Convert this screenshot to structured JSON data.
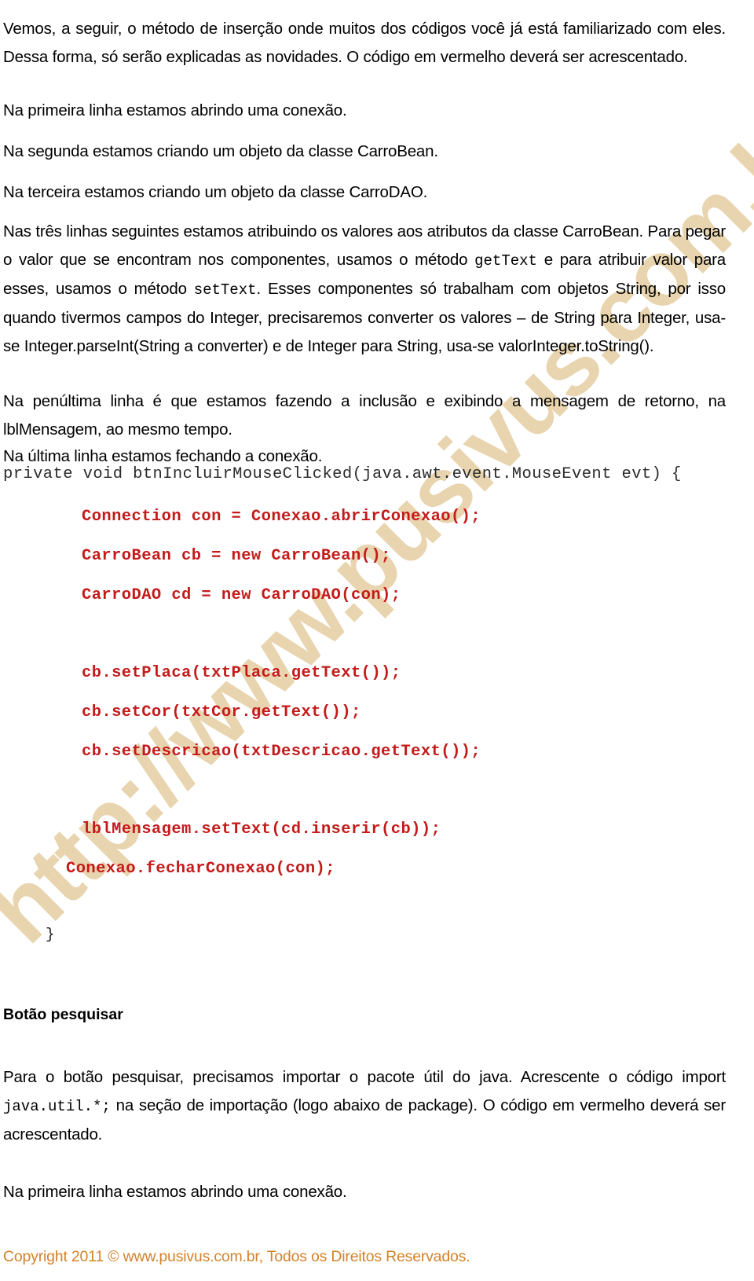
{
  "watermark": {
    "text": "http://www.pusivus.com.br"
  },
  "document": {
    "paragraphs": [
      {
        "id": "intro",
        "text": "Vemos, a seguir, o método de inserção onde muitos dos códigos você já está familiarizado com eles. Dessa forma, só serão explicadas as novidades. O código em vermelho deverá ser acrescentado."
      },
      {
        "id": "linha-1",
        "text": "Na primeira linha estamos abrindo uma conexão."
      },
      {
        "id": "linha-2",
        "text": "Na segunda estamos criando um objeto da classe CarroBean."
      },
      {
        "id": "linha-3",
        "text": "Na terceira estamos criando um objeto da classe CarroDAO."
      },
      {
        "id": "penultima",
        "text": "Na penúltima linha é que estamos fazendo a inclusão e exibindo a mensagem de retorno, na lblMensagem, ao mesmo tempo."
      },
      {
        "id": "ultima",
        "text": "Na última linha estamos fechando a conexão."
      },
      {
        "id": "primeira-linha-2",
        "text": "Na primeira linha estamos abrindo uma conexão."
      }
    ],
    "atributos_paragraph": {
      "part1": "Nas três linhas seguintes estamos atribuindo os valores aos atributos da classe CarroBean. Para pegar o valor que se encontram nos componentes, usamos o método ",
      "mono1": "getText",
      "part2": " e para atribuir valor para esses, usamos o método ",
      "mono2": "setText",
      "part3": ". Esses componentes só trabalham com objetos String, por isso quando tivermos campos do Integer, precisaremos converter os valores – de String para Integer, usa-se Integer.parseInt(String a converter) e de Integer para String, usa-se valorInteger.toString()."
    },
    "heading": "Botão pesquisar",
    "pesquisar_paragraph": {
      "part1": "Para o botão pesquisar, precisamos importar o pacote útil do java. Acrescente o código import ",
      "mono1": "java.util.*;",
      "part2": " na seção de importação (logo abaixo de package). O código em vermelho deverá ser acrescentado."
    }
  },
  "code_block": {
    "signature": "private void btnIncluirMouseClicked(java.awt.event.MouseEvent evt) {",
    "lines": [
      "Connection con = Conexao.abrirConexao();",
      "CarroBean cb = new CarroBean();",
      "CarroDAO cd = new CarroDAO(con);",
      "cb.setPlaca(txtPlaca.getText());",
      "cb.setCor(txtCor.getText());",
      "cb.setDescricao(txtDescricao.getText());",
      "lblMensagem.setText(cd.inserir(cb));",
      "Conexao.fecharConexao(con);"
    ],
    "closing_brace": "}",
    "red_color": "#c41a1a"
  },
  "footer": {
    "text": "Copyright 2011 © www.pusivus.com.br, Todos os Direitos Reservados.",
    "color": "#d2822b"
  }
}
